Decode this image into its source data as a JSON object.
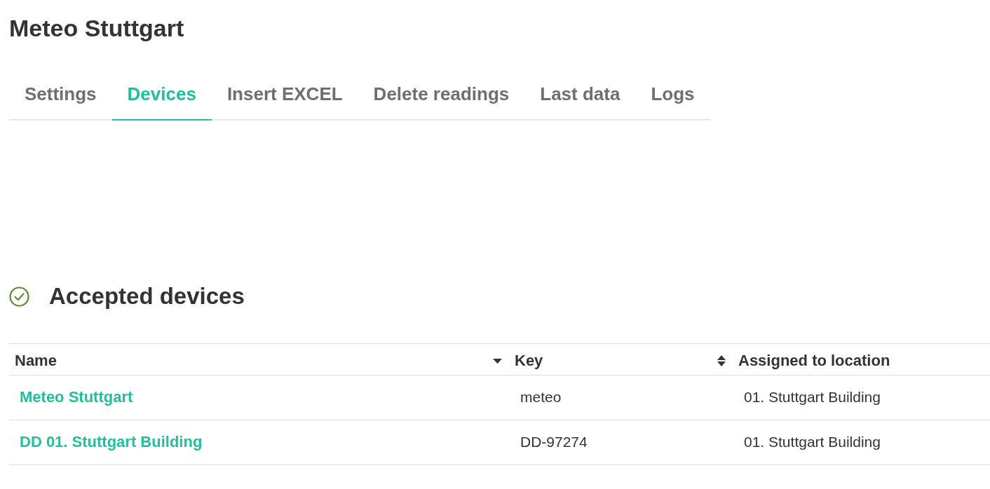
{
  "page": {
    "title": "Meteo Stuttgart"
  },
  "tabs": [
    {
      "label": "Settings",
      "selected": false
    },
    {
      "label": "Devices",
      "selected": true
    },
    {
      "label": "Insert EXCEL",
      "selected": false
    },
    {
      "label": "Delete readings",
      "selected": false
    },
    {
      "label": "Last data",
      "selected": false
    },
    {
      "label": "Logs",
      "selected": false
    }
  ],
  "section": {
    "title": "Accepted devices"
  },
  "table": {
    "columns": [
      {
        "label": "Name",
        "sortable": true,
        "sorted": true
      },
      {
        "label": "Key",
        "sortable": true,
        "sorted": false
      },
      {
        "label": "Assigned to location",
        "sortable": false
      }
    ],
    "rows": [
      {
        "name": "Meteo Stuttgart",
        "key": "meteo",
        "location": "01. Stuttgart Building"
      },
      {
        "name": "DD 01. Stuttgart Building",
        "key": "DD-97274",
        "location": "01. Stuttgart Building"
      }
    ]
  }
}
